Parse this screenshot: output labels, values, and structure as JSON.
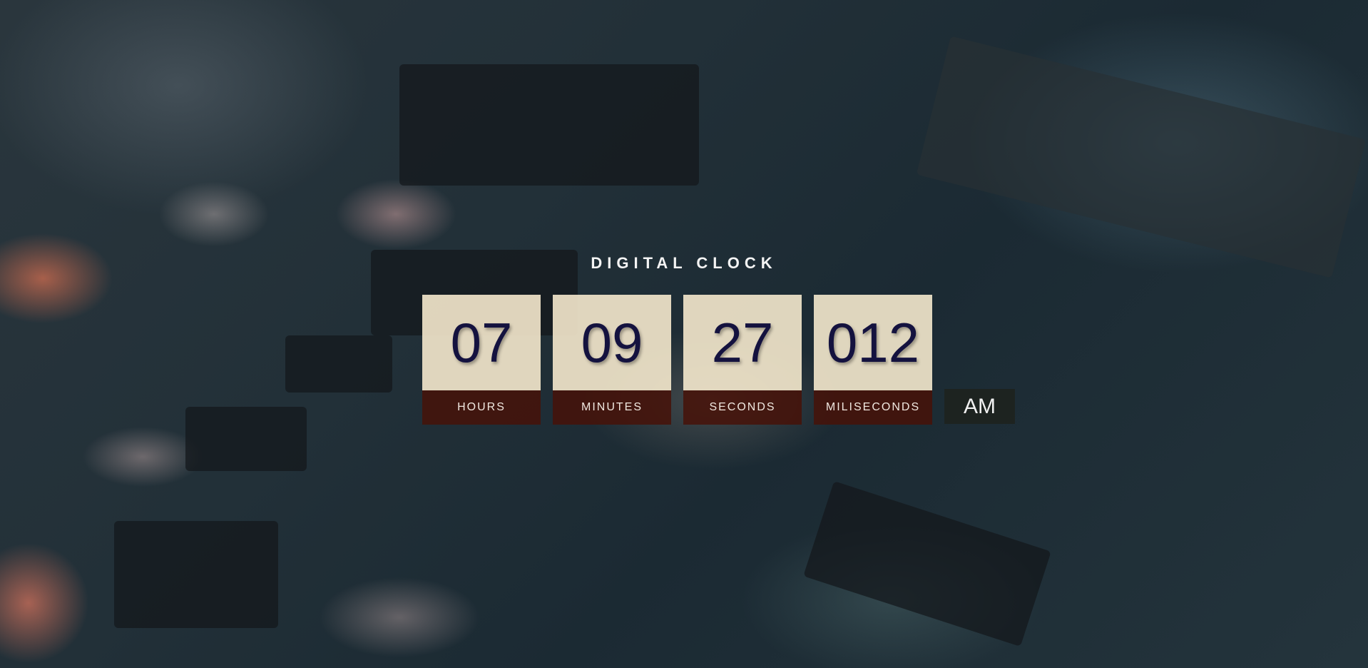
{
  "title": "DIGITAL CLOCK",
  "clock": [
    {
      "value": "07",
      "label": "HOURS"
    },
    {
      "value": "09",
      "label": "MINUTES"
    },
    {
      "value": "27",
      "label": "SECONDS"
    },
    {
      "value": "012",
      "label": "MILISECONDS"
    }
  ],
  "period": "AM",
  "colors": {
    "digit_panel": "#f5e9cd",
    "digit_text": "#14123f",
    "label_panel": "#46120a",
    "period_panel": "#1e221e"
  }
}
